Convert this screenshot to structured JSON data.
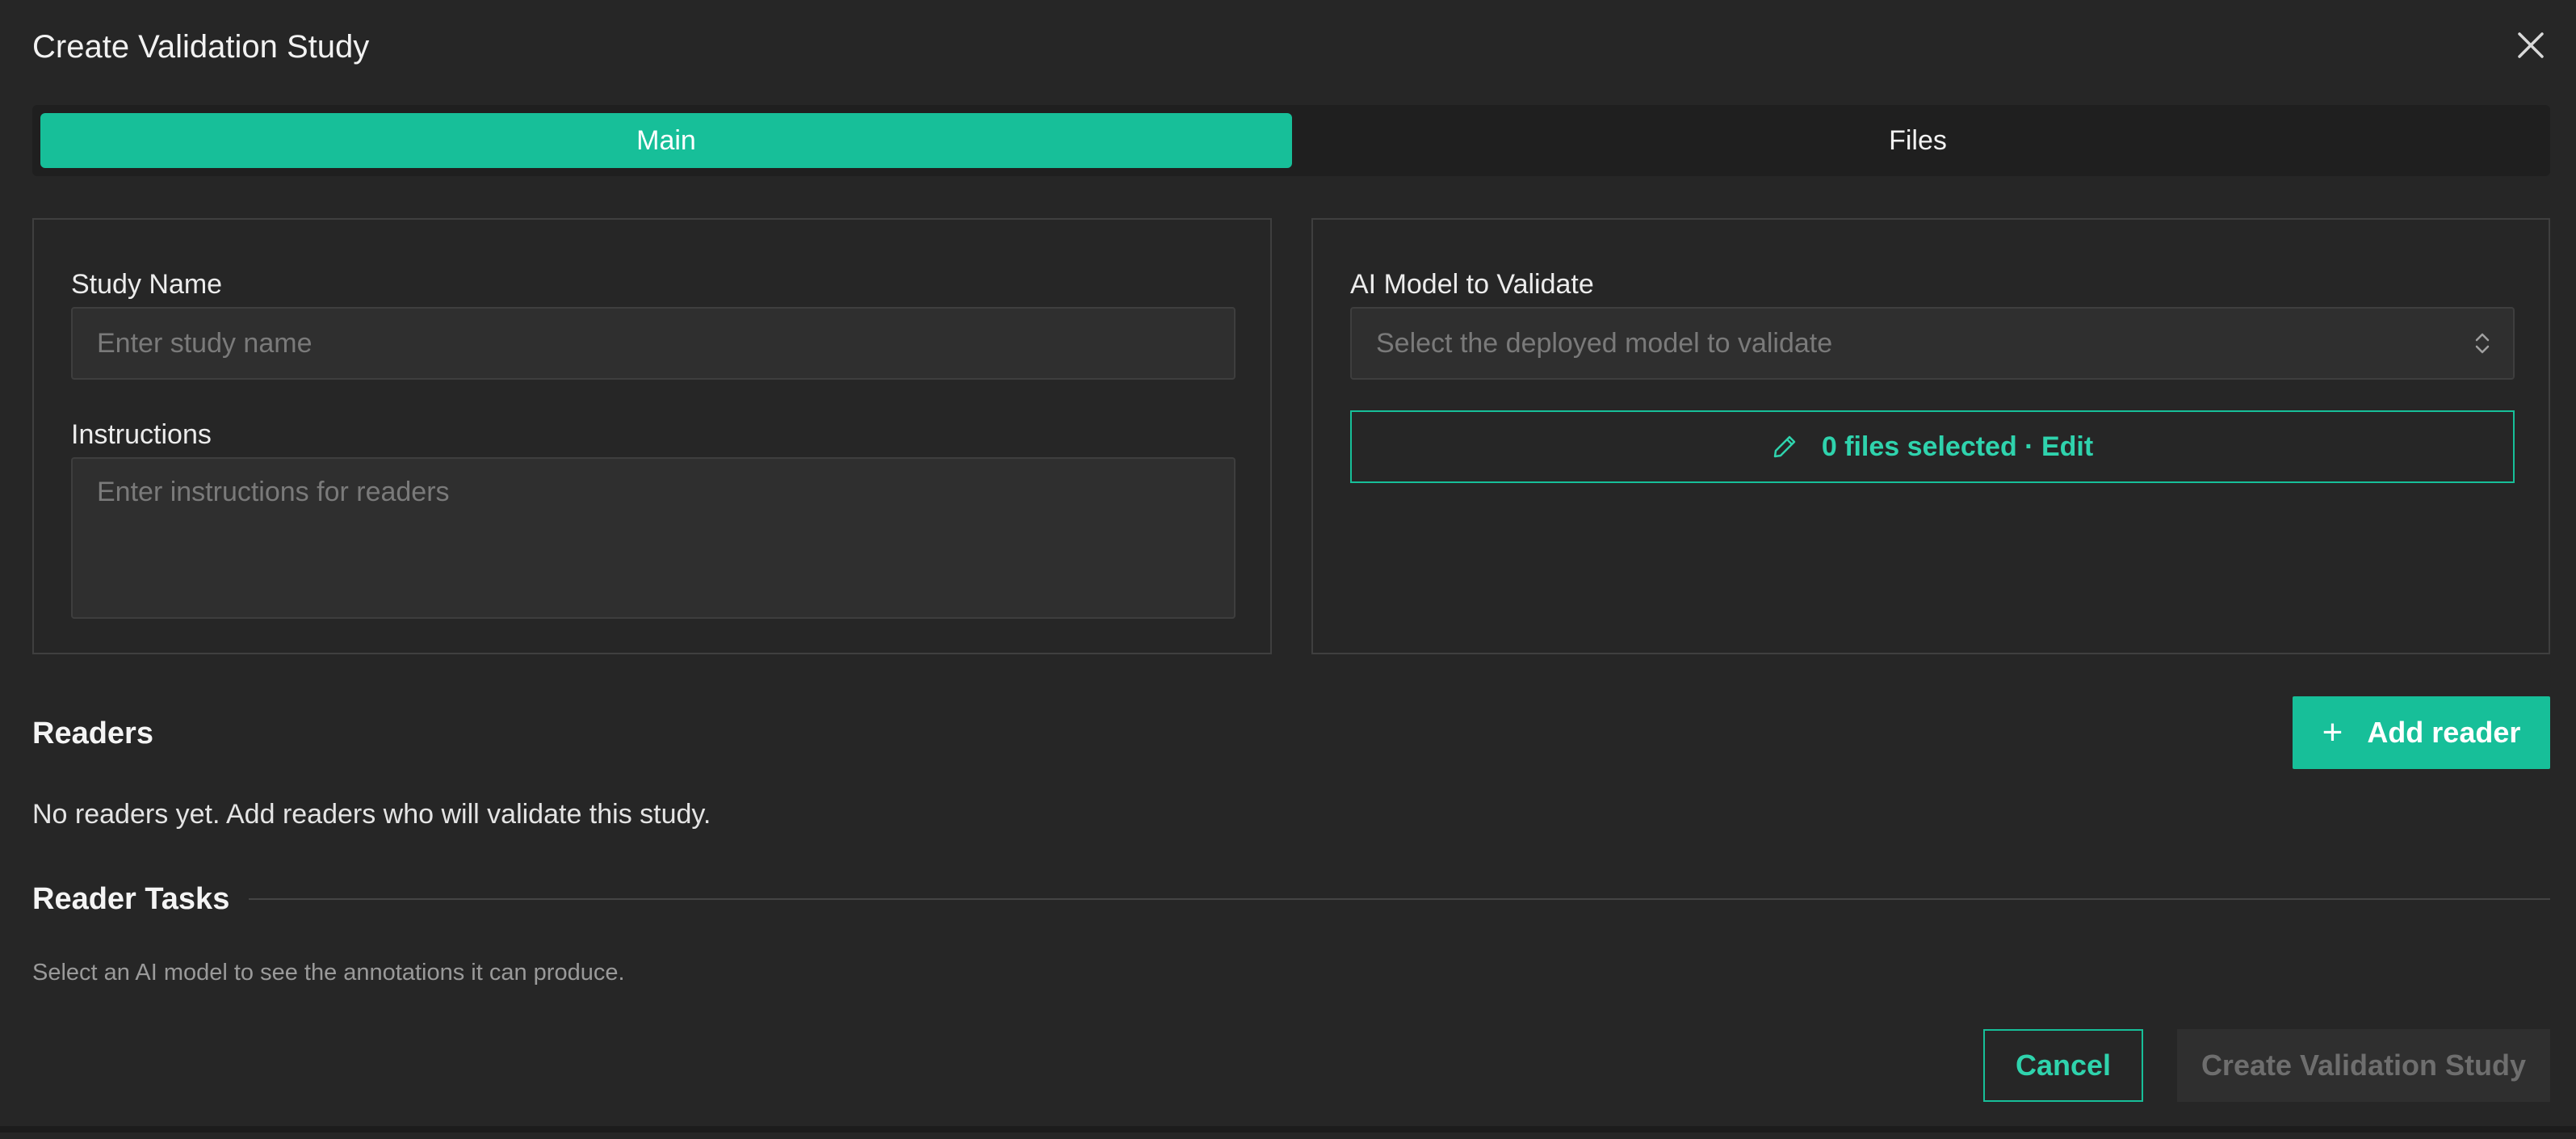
{
  "dialog": {
    "title": "Create Validation Study"
  },
  "tabs": [
    {
      "label": "Main",
      "active": true
    },
    {
      "label": "Files",
      "active": false
    }
  ],
  "main_panel": {
    "study_name_label": "Study Name",
    "study_name_placeholder": "Enter study name",
    "study_name_value": "",
    "instructions_label": "Instructions",
    "instructions_placeholder": "Enter instructions for readers",
    "instructions_value": ""
  },
  "model_panel": {
    "model_label": "AI Model to Validate",
    "model_placeholder": "Select the deployed model to validate",
    "files_button_label": "0 files selected · Edit"
  },
  "readers": {
    "title": "Readers",
    "add_button_label": "Add reader",
    "empty_message": "No readers yet. Add readers who will validate this study."
  },
  "reader_tasks": {
    "title": "Reader Tasks",
    "hint": "Select an AI model to see the annotations it can produce."
  },
  "footer": {
    "cancel_label": "Cancel",
    "create_label": "Create Validation Study"
  },
  "colors": {
    "accent": "#17bf99",
    "background": "#262626",
    "disabled": "#2f2f2f"
  },
  "icons": {
    "close": "close-icon",
    "pencil": "pencil-icon",
    "plus": "plus-icon",
    "select_caret": "chevron-up-down-icon"
  }
}
